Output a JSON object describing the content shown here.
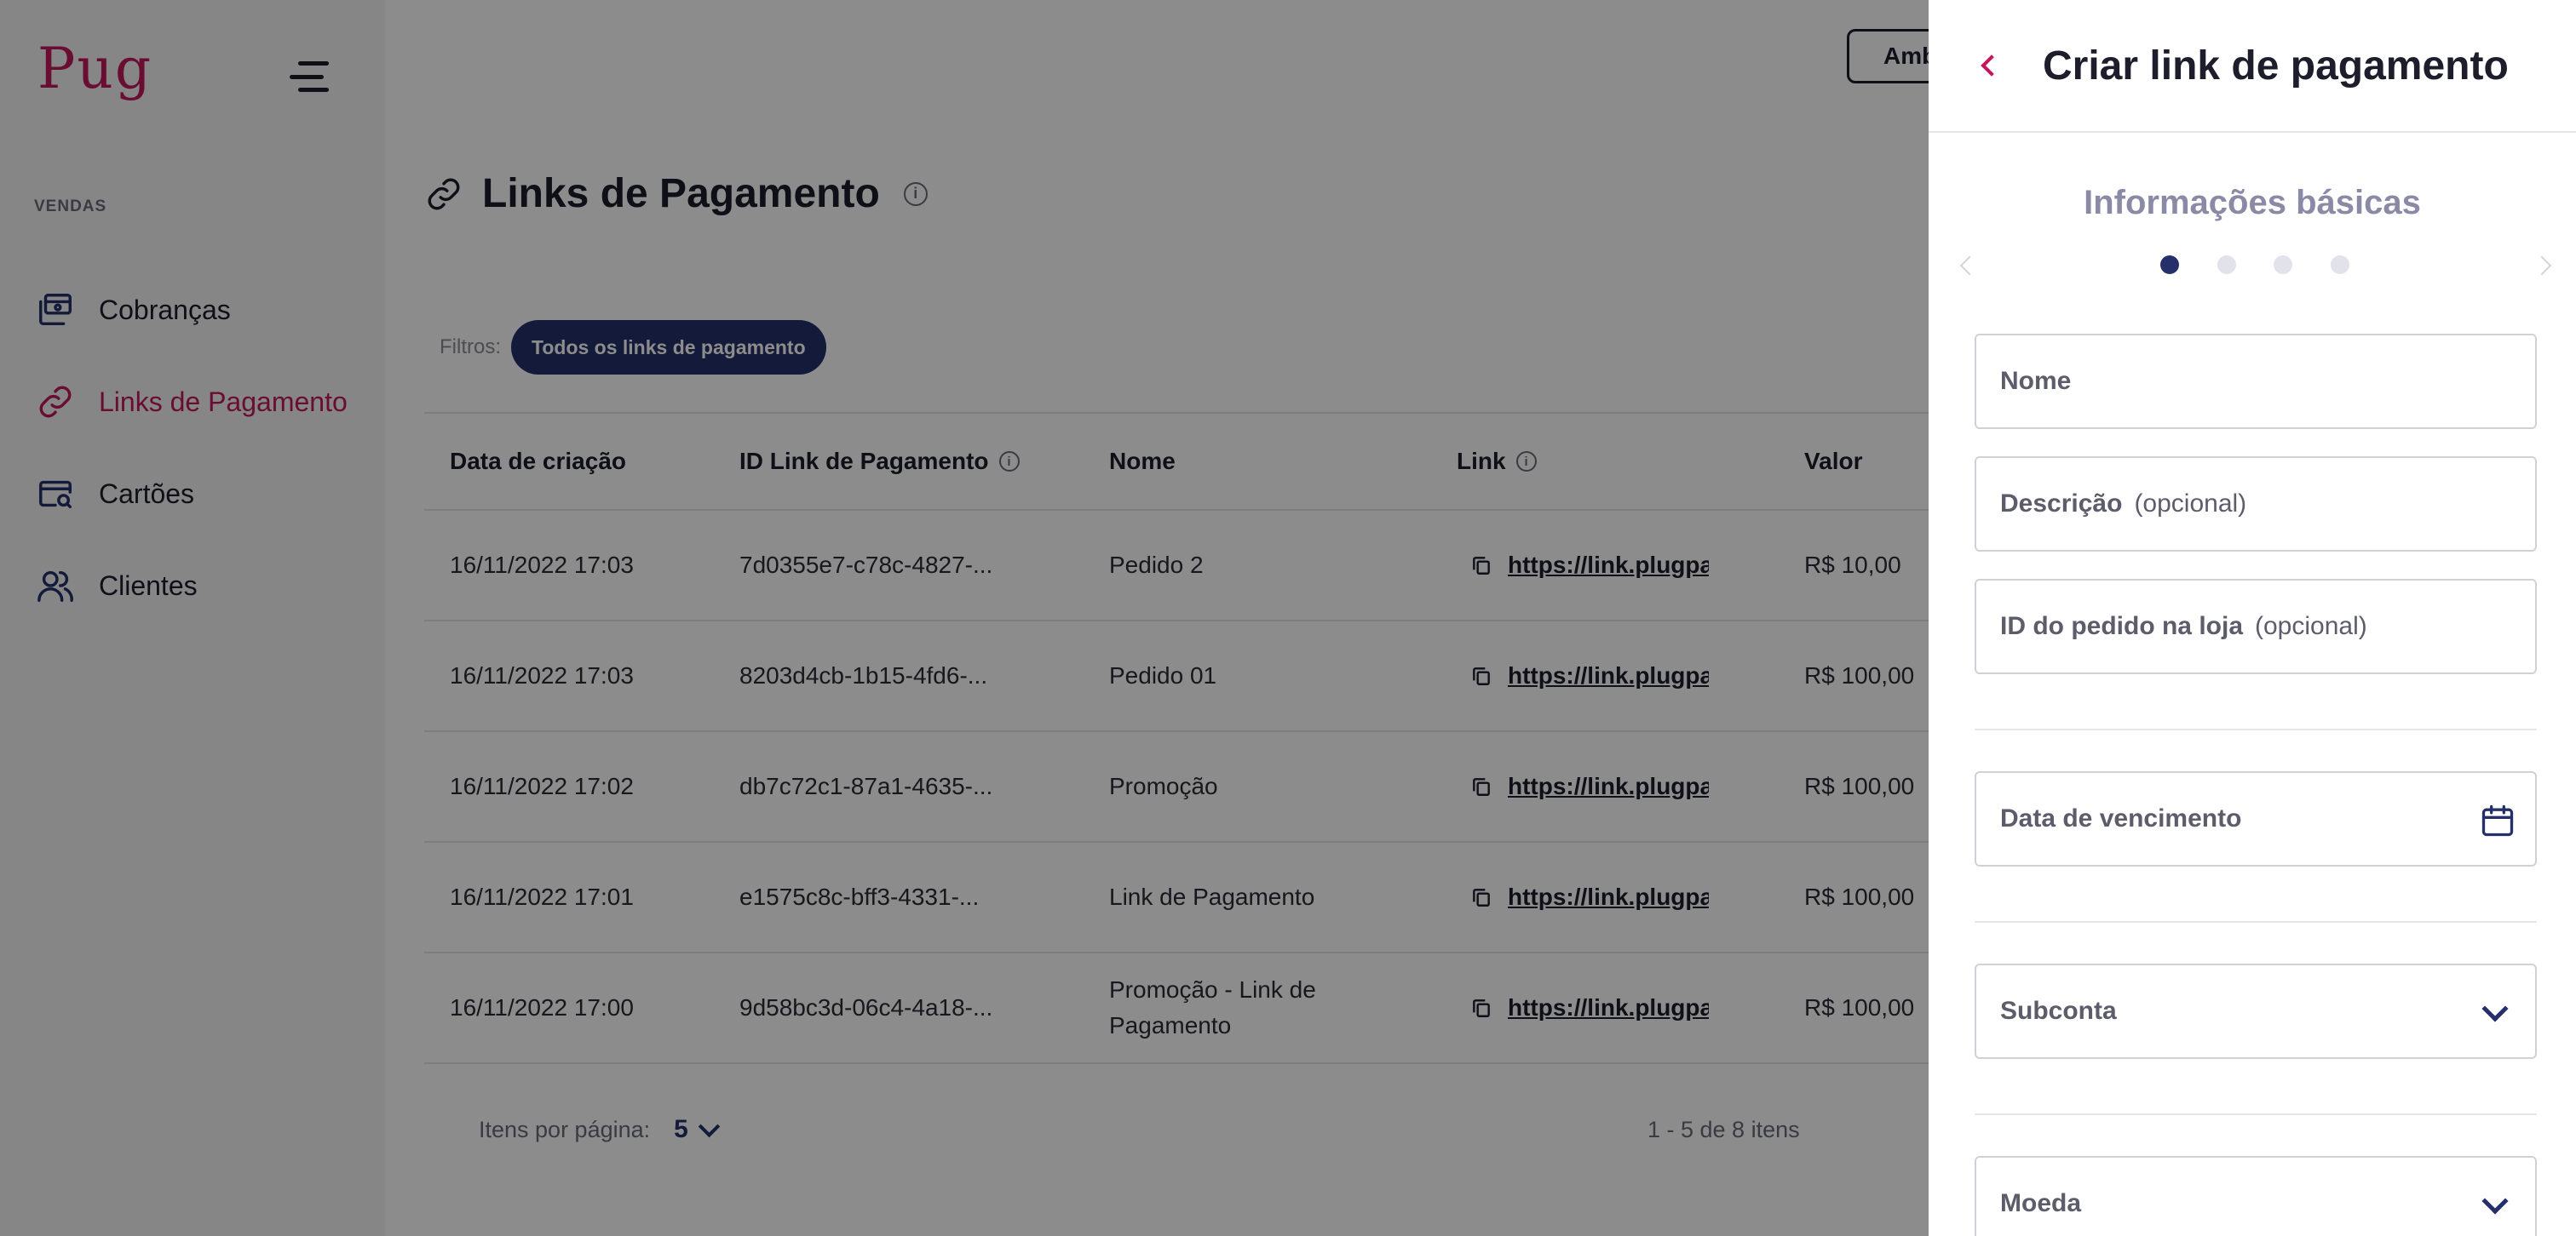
{
  "sidebar": {
    "logo": "Pug",
    "section": "VENDAS",
    "items": [
      {
        "label": "Cobranças",
        "icon": "billing-icon"
      },
      {
        "label": "Links de Pagamento",
        "icon": "link-icon"
      },
      {
        "label": "Cartões",
        "icon": "card-search-icon"
      },
      {
        "label": "Clientes",
        "icon": "users-icon"
      }
    ]
  },
  "header": {
    "environment_label": "Amb"
  },
  "page": {
    "title": "Links de Pagamento",
    "filters_label": "Filtros:",
    "filter_chip": "Todos os links de pagamento"
  },
  "table": {
    "columns": [
      "Data de criação",
      "ID Link de Pagamento",
      "Nome",
      "Link",
      "Valor"
    ],
    "rows": [
      {
        "date": "16/11/2022 17:03",
        "id": "7d0355e7-c78c-4827-...",
        "name": "Pedido 2",
        "link": "https://link.plugpag",
        "value": "R$ 10,00"
      },
      {
        "date": "16/11/2022 17:03",
        "id": "8203d4cb-1b15-4fd6-...",
        "name": "Pedido 01",
        "link": "https://link.plugpag",
        "value": "R$ 100,00"
      },
      {
        "date": "16/11/2022 17:02",
        "id": "db7c72c1-87a1-4635-...",
        "name": "Promoção",
        "link": "https://link.plugpag",
        "value": "R$ 100,00"
      },
      {
        "date": "16/11/2022 17:01",
        "id": "e1575c8c-bff3-4331-...",
        "name": "Link de Pagamento",
        "link": "https://link.plugpag",
        "value": "R$ 100,00"
      },
      {
        "date": "16/11/2022 17:00",
        "id": "9d58bc3d-06c4-4a18-...",
        "name": "Promoção - Link de Pagamento",
        "link": "https://link.plugpag",
        "value": "R$ 100,00"
      }
    ]
  },
  "pager": {
    "per_page_label": "Itens por página:",
    "per_page_value": "5",
    "range": "1 - 5 de 8 itens"
  },
  "drawer": {
    "title": "Criar link de pagamento",
    "step_title": "Informações básicas",
    "steps": 4,
    "active_step": 1,
    "optional_label": "(opcional)",
    "fields": {
      "name": "Nome",
      "description": "Descrição",
      "order_id": "ID do pedido na loja",
      "due_date": "Data de vencimento",
      "subaccount": "Subconta",
      "currency": "Moeda"
    }
  },
  "colors": {
    "brand": "#c2185b",
    "primary": "#25306b",
    "overlay": "#000000"
  }
}
